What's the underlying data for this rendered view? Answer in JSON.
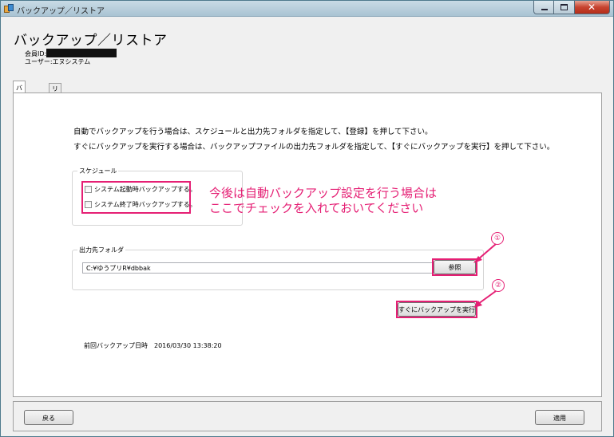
{
  "window": {
    "title": "バックアップ／リストア"
  },
  "page": {
    "title": "バックアップ／リストア",
    "member_id_label": "会員ID:",
    "user_label": "ユーザー:エヌシステム"
  },
  "tabs": [
    {
      "label": "バックアップ",
      "active": true
    },
    {
      "label": "リストア",
      "active": false
    }
  ],
  "description": {
    "line1": "自動でバックアップを行う場合は、スケジュールと出力先フォルダを指定して、【登録】を押して下さい。",
    "line2": "すぐにバックアップを実行する場合は、バックアップファイルの出力先フォルダを指定して、【すぐにバックアップを実行】を押して下さい。"
  },
  "schedule": {
    "legend": "スケジュール",
    "options": [
      {
        "label": "システム起動時バックアップする。",
        "checked": false
      },
      {
        "label": "システム終了時バックアップする。",
        "checked": false
      }
    ]
  },
  "annotation": {
    "line1": "今後は自動バックアップ設定を行う場合は",
    "line2": "ここでチェックを入れておいてください",
    "step1": "①",
    "step2": "②",
    "color": "#e51f74"
  },
  "output_folder": {
    "legend": "出力先フォルダ",
    "path": "C:¥ゆうプリR¥dbbak",
    "browse_label": "参照"
  },
  "run_now_label": "すぐにバックアップを実行",
  "last_backup": "前回バックアップ日時　2016/03/30 13:38:20",
  "footer": {
    "back_label": "戻る",
    "apply_label": "適用"
  }
}
